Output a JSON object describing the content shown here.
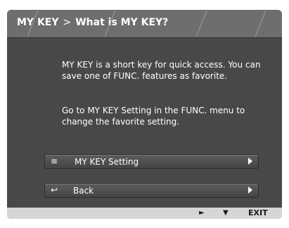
{
  "header": {
    "parent": "MY KEY",
    "separator": ">",
    "title": "What is MY KEY?"
  },
  "description": {
    "paragraph1": "MY KEY is a short key for quick access. You can save one of FUNC. features as favorite.",
    "paragraph2": "Go to MY KEY Setting in the FUNC. menu to change the favorite setting."
  },
  "menu": {
    "items": [
      {
        "label": "MY KEY Setting",
        "icon": "settings-sliders-icon"
      },
      {
        "label": "Back",
        "icon": "return-arrow-icon"
      }
    ]
  },
  "footer": {
    "right_symbol": "►",
    "down_symbol": "▼",
    "exit_label": "EXIT"
  }
}
